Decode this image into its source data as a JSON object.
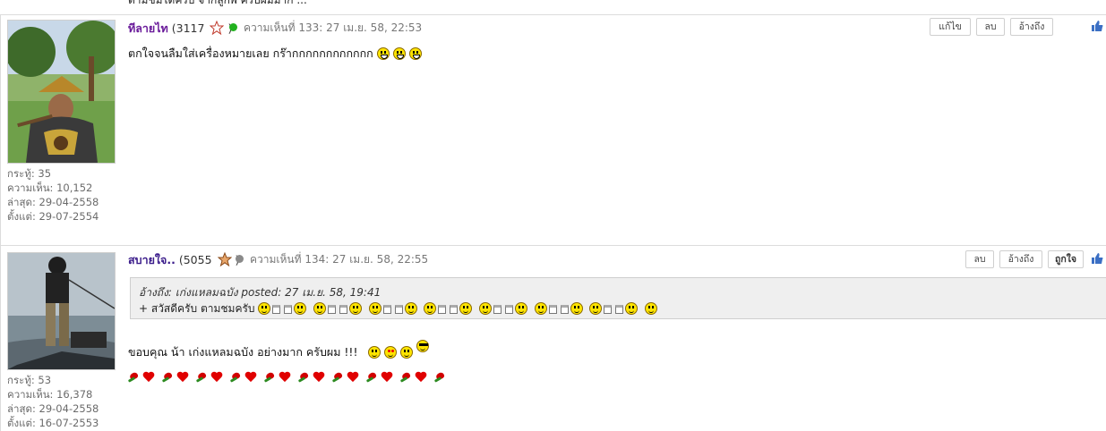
{
  "top_snippet": "ตามชมได้ครับ จากลูกพี่ ครับผมมาก ...",
  "posts": [
    {
      "username": "ทีลายไท",
      "post_count": "(3117",
      "close_paren": ")",
      "online_status": "online",
      "comment_time": "ความเห็นที่ 133: 27 เม.ย. 58, 22:53",
      "buttons": [
        "แก้ไข",
        "ลบ",
        "อ้างถึง"
      ],
      "message": "ตกใจจนลืมใส่เครื่องหมายเลย กร๊ากกกกกกกกกกกก",
      "stats": [
        "กระทู้: 35",
        "ความเห็น: 10,152",
        "ล่าสุด: 29-04-2558",
        "ตั้งแต่: 29-07-2554"
      ]
    },
    {
      "username": "สบายใจ..",
      "post_count": "(5055",
      "close_paren": ")",
      "online_status": "offline",
      "comment_time": "ความเห็นที่ 134: 27 เม.ย. 58, 22:55",
      "buttons": [
        "ลบ",
        "อ้างถึง",
        "ถูกใจ"
      ],
      "quote_header": "อ้างถึง: เก่งแหลมฉบัง posted: 27 เม.ย. 58, 19:41",
      "quote_text": "+ สวัสดีครับ ตามชมครับ",
      "message": "ขอบคุณ น้า เก่งแหลมฉบัง อย่างมาก ครับผม !!!",
      "stats": [
        "กระทู้: 53",
        "ความเห็น: 16,378",
        "ล่าสุด: 29-04-2558",
        "ตั้งแต่: 16-07-2553"
      ]
    }
  ],
  "colors": {
    "online": "#22b21f",
    "offline": "#8a8a8a",
    "username": "#6a1b9a",
    "like_icon": "#3b6fc4"
  }
}
